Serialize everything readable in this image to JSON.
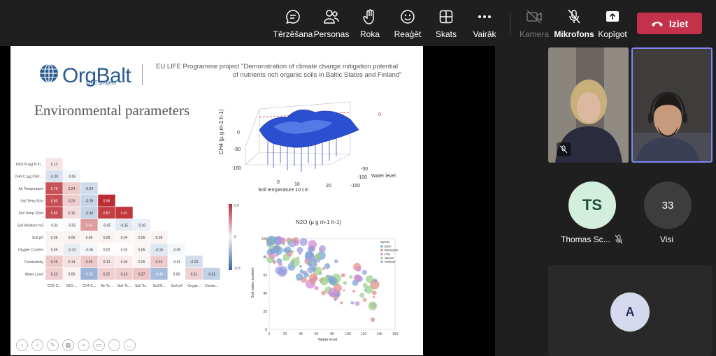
{
  "toolbar": {
    "chat": "Tērzēšana",
    "people": "Personas",
    "raise_hand": "Roka",
    "react": "Reaģēt",
    "view": "Skats",
    "more": "Vairāk",
    "camera": "Kamera",
    "mic": "Mikrofons",
    "share": "Kopīgot",
    "leave": "Iziet"
  },
  "slide": {
    "logo": "OrgBalt",
    "logo_sub": "LIFE project",
    "project_line1": "EU LIFE Programme project \"Demonstration of climate change mitigation potential",
    "project_line2": "of nutrients rich organic soils in Baltic States and Finland\"",
    "title": "Environmental parameters",
    "matrix": {
      "rows": [
        "N2O-N (µg N m...",
        "CH4-C (µg CH4 ...",
        "Air Temperature",
        "Soil Temp 5cm",
        "Soil Temp 10cm",
        "Soil Moisture m3",
        "Soil pH",
        "Oxygen Content",
        "Conductivity",
        "Water Level"
      ],
      "cols": [
        "CO2-C...",
        "N2O-...",
        "CH4-C...",
        "Air Te...",
        "Soil Te...",
        "Soil Te...",
        "Soil M...",
        "Soil pH",
        "Oxyge...",
        "Condu..."
      ],
      "values": [
        [
          0.12
        ],
        [
          -0.2,
          -0.06
        ],
        [
          0.78,
          0.24,
          -0.24
        ],
        [
          0.8,
          0.23,
          -0.28,
          0.96
        ],
        [
          0.8,
          0.16,
          -0.3,
          0.87,
          0.91
        ],
        [
          -0.01,
          -0.03,
          0.45,
          -0.05,
          -0.15,
          -0.1
        ],
        [
          0.06,
          0.06,
          0.06,
          0.06,
          0.04,
          0.05,
          0.06
        ],
        [
          0.05,
          -0.12,
          -0.06,
          0.02,
          0.02,
          0.05,
          -0.16,
          -0.05
        ],
        [
          0.25,
          0.14,
          0.25,
          0.13,
          0.09,
          0.05,
          0.24,
          -0.01,
          -0.23
        ],
        [
          0.23,
          0.06,
          -0.5,
          0.22,
          0.23,
          0.27,
          -0.45,
          -0.0,
          0.21,
          -0.31
        ]
      ],
      "scale_ticks": [
        "0.5",
        "0",
        "-0.5"
      ]
    },
    "surface": {
      "ylabel": "CH4 (µ g m-1 h-1)",
      "xlabel": "Soil temperature 10 cm",
      "zlabel": "Water level",
      "y_ticks": [
        "0",
        "-80",
        "-160"
      ],
      "x_ticks": [
        "0",
        "10",
        "20"
      ],
      "z_ticks": [
        "-50",
        "-100",
        "-150"
      ],
      "side_ticks": [
        "0"
      ]
    },
    "scatter": {
      "title": "N2O (µ g m-1 h-1)",
      "xlabel": "Water level",
      "ylabel": "Soil water content",
      "x_ticks": [
        "0",
        "20",
        "40",
        "60",
        "80",
        "100",
        "120",
        "140",
        "160"
      ],
      "y_ticks": [
        "100",
        "80",
        "60",
        "40",
        "20",
        "0"
      ],
      "legend_title": "Specie",
      "legend": [
        {
          "name": "Birch",
          "color": "#7aa6d6"
        },
        {
          "name": "Blackalder",
          "color": "#e0908c"
        },
        {
          "name": "Pine",
          "color": "#d28fd4"
        },
        {
          "name": "Spruce",
          "color": "#9fd08c"
        },
        {
          "name": "Wetland",
          "color": "#9aa0e0"
        }
      ]
    }
  },
  "participants": {
    "ts_initials": "TS",
    "ts_name": "Thomas Sc...",
    "count": "33",
    "count_label": "Visi",
    "a_initial": "A"
  },
  "colors": {
    "leave": "#c4314b",
    "ts_avatar": "#d3eedc",
    "a_avatar": "#d6d8ee",
    "active_border": "#7f85f5"
  }
}
